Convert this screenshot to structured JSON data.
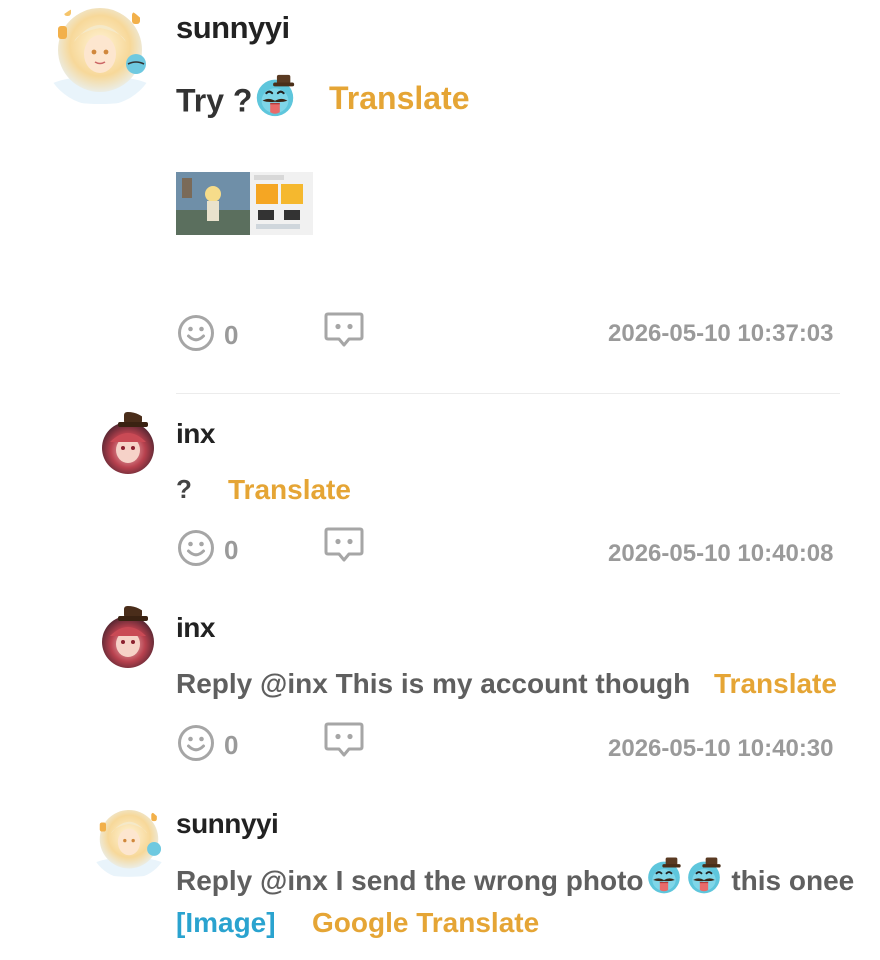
{
  "comment": {
    "author": "sunnyyi",
    "text": "Try ?",
    "translate_label": "Translate",
    "reactions": "0",
    "timestamp": "2026-05-10 10:37:03"
  },
  "replies": [
    {
      "author": "inx",
      "text": "?",
      "translate_label": "Translate",
      "reactions": "0",
      "timestamp": "2026-05-10 10:40:08"
    },
    {
      "author": "inx",
      "text": "Reply @inx This is my account though",
      "translate_label": "Translate",
      "reactions": "0",
      "timestamp": "2026-05-10 10:40:30"
    },
    {
      "author": "sunnyyi",
      "text_before": "Reply @inx I send the wrong photo",
      "text_after": " this onee",
      "image_link": "[Image]",
      "translate_label": "Google Translate"
    }
  ],
  "icons": {
    "reaction": "smiley-icon",
    "reply": "comment-bubble-icon",
    "emoji": "mustache-ghost-emoji"
  },
  "colors": {
    "accent_translate": "#e5a535",
    "image_link": "#2aa3cf",
    "meta_gray": "#9a9a9a"
  }
}
